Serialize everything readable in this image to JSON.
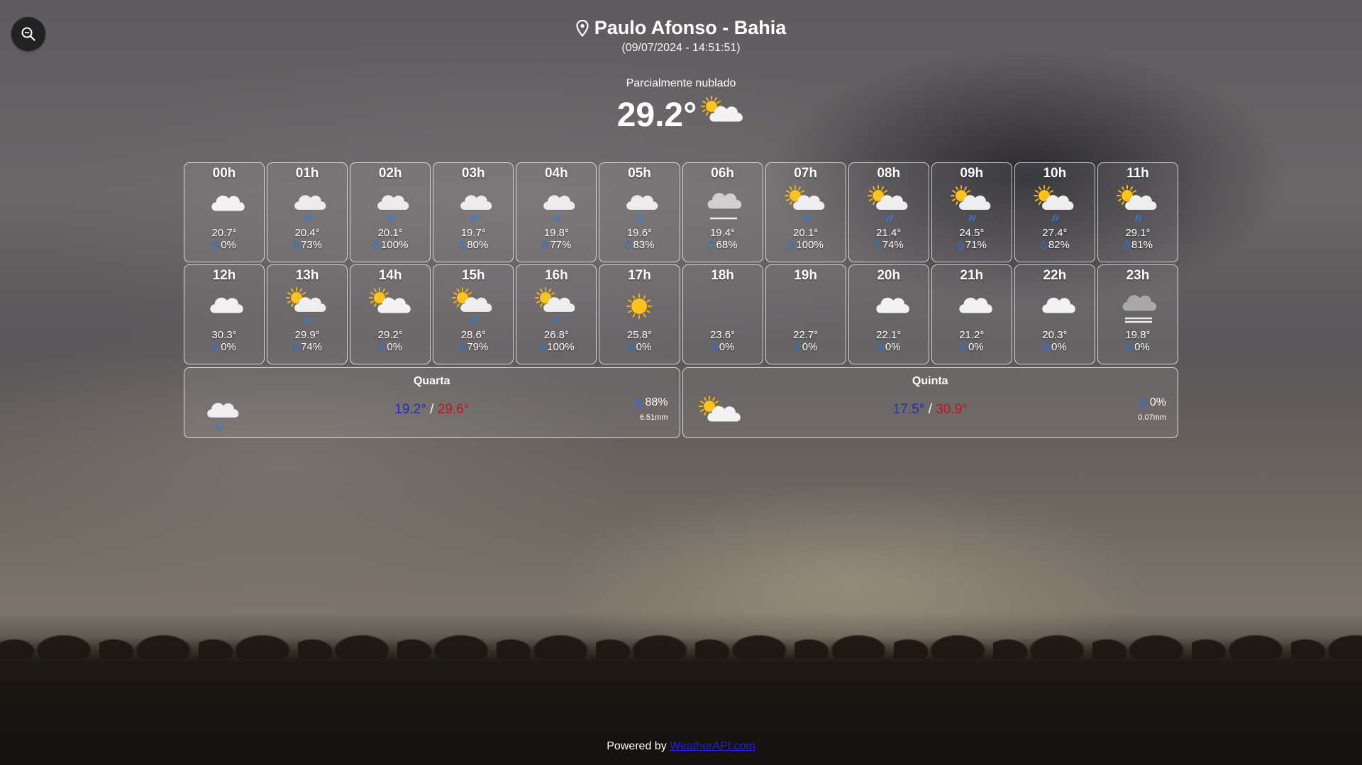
{
  "search": {
    "icon": "search-zoom-icon"
  },
  "location": {
    "icon": "map-pin-icon",
    "city": "Paulo Afonso - Bahia",
    "datetime": "(09/07/2024 - 14:51:51)"
  },
  "current": {
    "condition": "Parcialmente nublado",
    "temp": "29.2°",
    "icon": "partly-cloudy-day-icon"
  },
  "hours": [
    {
      "h": "00h",
      "t": "20.7°",
      "r": "0%",
      "icon": "night-cloudy"
    },
    {
      "h": "01h",
      "t": "20.4°",
      "r": "73%",
      "icon": "night-rain"
    },
    {
      "h": "02h",
      "t": "20.1°",
      "r": "100%",
      "icon": "night-rain"
    },
    {
      "h": "03h",
      "t": "19.7°",
      "r": "80%",
      "icon": "night-rain"
    },
    {
      "h": "04h",
      "t": "19.8°",
      "r": "77%",
      "icon": "night-rain"
    },
    {
      "h": "05h",
      "t": "19.6°",
      "r": "83%",
      "icon": "night-rain"
    },
    {
      "h": "06h",
      "t": "19.4°",
      "r": "68%",
      "icon": "fog"
    },
    {
      "h": "07h",
      "t": "20.1°",
      "r": "100%",
      "icon": "day-rain"
    },
    {
      "h": "08h",
      "t": "21.4°",
      "r": "74%",
      "icon": "day-rain"
    },
    {
      "h": "09h",
      "t": "24.5°",
      "r": "71%",
      "icon": "day-rain"
    },
    {
      "h": "10h",
      "t": "27.4°",
      "r": "82%",
      "icon": "day-rain"
    },
    {
      "h": "11h",
      "t": "29.1°",
      "r": "81%",
      "icon": "day-rain"
    },
    {
      "h": "12h",
      "t": "30.3°",
      "r": "0%",
      "icon": "cloudy"
    },
    {
      "h": "13h",
      "t": "29.9°",
      "r": "74%",
      "icon": "day-rain"
    },
    {
      "h": "14h",
      "t": "29.2°",
      "r": "0%",
      "icon": "day-cloudy"
    },
    {
      "h": "15h",
      "t": "28.6°",
      "r": "79%",
      "icon": "day-rain"
    },
    {
      "h": "16h",
      "t": "26.8°",
      "r": "100%",
      "icon": "day-rain"
    },
    {
      "h": "17h",
      "t": "25.8°",
      "r": "0%",
      "icon": "sun"
    },
    {
      "h": "18h",
      "t": "23.6°",
      "r": "0%",
      "icon": "moon"
    },
    {
      "h": "19h",
      "t": "22.7°",
      "r": "0%",
      "icon": "moon"
    },
    {
      "h": "20h",
      "t": "22.1°",
      "r": "0%",
      "icon": "night-cloudy"
    },
    {
      "h": "21h",
      "t": "21.2°",
      "r": "0%",
      "icon": "night-cloudy"
    },
    {
      "h": "22h",
      "t": "20.3°",
      "r": "0%",
      "icon": "night-cloudy"
    },
    {
      "h": "23h",
      "t": "19.8°",
      "r": "0%",
      "icon": "fog-dark"
    }
  ],
  "days": [
    {
      "name": "Quarta",
      "min": "19.2°",
      "sep": "/",
      "max": "29.6°",
      "rain": "88%",
      "mm": "6.51mm",
      "icon": "cloud-rain"
    },
    {
      "name": "Quinta",
      "min": "17.5°",
      "sep": "/",
      "max": "30.9°",
      "rain": "0%",
      "mm": "0.07mm",
      "icon": "day-cloudy"
    }
  ],
  "footer": {
    "prefix": "Powered by",
    "link": "WeatherAPI.com"
  },
  "colors": {
    "min_temp": "#1f2fb8",
    "max_temp": "#c0161a",
    "link": "#1e22d8",
    "raindrop": "#2c6fd6"
  }
}
